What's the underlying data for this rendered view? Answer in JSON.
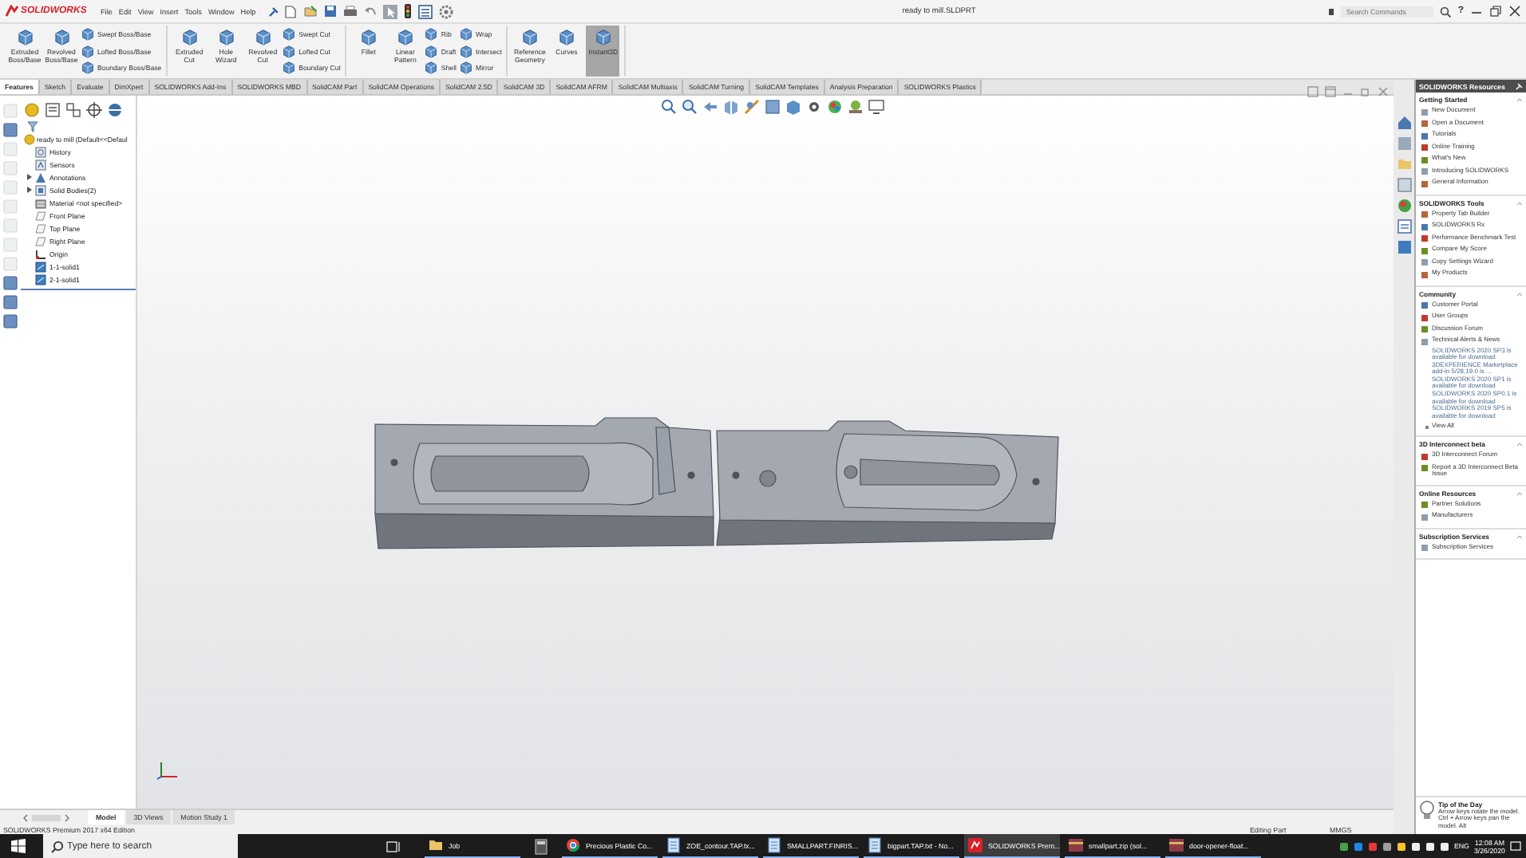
{
  "title_bar": {
    "logo": "SOLIDWORKS",
    "menus": [
      "File",
      "Edit",
      "View",
      "Insert",
      "Tools",
      "Window",
      "Help"
    ],
    "title": "ready to mill.SLDPRT",
    "search": {
      "placeholder": "Search Commands"
    },
    "help": "?"
  },
  "ribbon": {
    "groups": [
      {
        "items": [
          {
            "kind": "large",
            "label": "Extruded Boss/Base",
            "selected": false
          },
          {
            "kind": "large",
            "label": "Revolved Boss/Base",
            "selected": false
          },
          {
            "kind": "stack",
            "children": [
              "Swept Boss/Base",
              "Lofted Boss/Base",
              "Boundary Boss/Base"
            ]
          }
        ]
      },
      {
        "items": [
          {
            "kind": "large",
            "label": "Extruded Cut",
            "selected": false
          },
          {
            "kind": "large",
            "label": "Hole Wizard",
            "selected": false
          },
          {
            "kind": "large",
            "label": "Revolved Cut",
            "selected": false
          },
          {
            "kind": "stack",
            "children": [
              "Swept Cut",
              "Lofted Cut",
              "Boundary Cut"
            ]
          }
        ]
      },
      {
        "items": [
          {
            "kind": "large",
            "label": "Fillet",
            "selected": false
          },
          {
            "kind": "large",
            "label": "Linear Pattern",
            "selected": false
          },
          {
            "kind": "stack",
            "children": [
              "Rib",
              "Draft",
              "Shell"
            ]
          },
          {
            "kind": "stack",
            "children": [
              "Wrap",
              "Intersect",
              "Mirror"
            ]
          }
        ]
      },
      {
        "items": [
          {
            "kind": "large",
            "label": "Reference Geometry",
            "selected": false
          },
          {
            "kind": "large",
            "label": "Curves",
            "selected": false
          },
          {
            "kind": "large",
            "label": "Instant3D",
            "selected": true
          }
        ]
      }
    ]
  },
  "command_tabs": [
    {
      "label": "Features",
      "selected": true
    },
    {
      "label": "Sketch",
      "selected": false
    },
    {
      "label": "Evaluate",
      "selected": false
    },
    {
      "label": "DimXpert",
      "selected": false
    },
    {
      "label": "SOLIDWORKS Add-Ins",
      "selected": false
    },
    {
      "label": "SOLIDWORKS MBD",
      "selected": false
    },
    {
      "label": "SolidCAM Part",
      "selected": false
    },
    {
      "label": "SolidCAM Operations",
      "selected": false
    },
    {
      "label": "SolidCAM 2.5D",
      "selected": false
    },
    {
      "label": "SolidCAM 3D",
      "selected": false
    },
    {
      "label": "SolidCAM AFRM",
      "selected": false
    },
    {
      "label": "SolidCAM Multiaxis",
      "selected": false
    },
    {
      "label": "SolidCAM Turning",
      "selected": false
    },
    {
      "label": "SolidCAM Templates",
      "selected": false
    },
    {
      "label": "Analysis Preparation",
      "selected": false
    },
    {
      "label": "SOLIDWORKS Plastics",
      "selected": false
    }
  ],
  "feature_tree": {
    "root": "ready to mill  (Default<<Defaul",
    "items": [
      {
        "label": "History",
        "kind": "folder",
        "expandable": false
      },
      {
        "label": "Sensors",
        "kind": "sensor",
        "expandable": false
      },
      {
        "label": "Annotations",
        "kind": "annotation",
        "expandable": true
      },
      {
        "label": "Solid Bodies(2)",
        "kind": "bodies",
        "expandable": true
      },
      {
        "label": "Material <not specified>",
        "kind": "material",
        "expandable": false
      },
      {
        "label": "Front Plane",
        "kind": "plane",
        "expandable": false
      },
      {
        "label": "Top Plane",
        "kind": "plane",
        "expandable": false
      },
      {
        "label": "Right Plane",
        "kind": "plane",
        "expandable": false
      },
      {
        "label": "Origin",
        "kind": "origin",
        "expandable": false
      },
      {
        "label": "1-1-solid1",
        "kind": "feature",
        "expandable": false
      },
      {
        "label": "2-1-solid1",
        "kind": "feature",
        "expandable": false
      }
    ]
  },
  "bottom_tabs": [
    {
      "label": "Model",
      "selected": true
    },
    {
      "label": "3D Views",
      "selected": false
    },
    {
      "label": "Motion Study 1",
      "selected": false
    }
  ],
  "status_bar": {
    "edition": "SOLIDWORKS Premium 2017 x64 Edition",
    "mode": "Editing Part",
    "units": "MMGS"
  },
  "task_pane": {
    "title": "SOLIDWORKS Resources",
    "sections": [
      {
        "title": "Getting Started",
        "items": [
          {
            "kind": "link",
            "label": "New Document"
          },
          {
            "kind": "link",
            "label": "Open a Document"
          },
          {
            "kind": "link",
            "label": "Tutorials"
          },
          {
            "kind": "link",
            "label": "Online Training"
          },
          {
            "kind": "link",
            "label": "What's New"
          },
          {
            "kind": "link",
            "label": "Introducing SOLIDWORKS"
          },
          {
            "kind": "link",
            "label": "General Information"
          }
        ]
      },
      {
        "title": "SOLIDWORKS Tools",
        "items": [
          {
            "kind": "link",
            "label": "Property Tab Builder"
          },
          {
            "kind": "link",
            "label": "SOLIDWORKS Rx"
          },
          {
            "kind": "link",
            "label": "Performance Benchmark Test"
          },
          {
            "kind": "link",
            "label": "Compare My Score"
          },
          {
            "kind": "link",
            "label": "Copy Settings Wizard"
          },
          {
            "kind": "link",
            "label": "My Products"
          }
        ]
      },
      {
        "title": "Community",
        "items": [
          {
            "kind": "link",
            "label": "Customer Portal"
          },
          {
            "kind": "link",
            "label": "User Groups"
          },
          {
            "kind": "link",
            "label": "Discussion Forum"
          },
          {
            "kind": "link",
            "label": "Technical Alerts & News"
          },
          {
            "kind": "news",
            "label": "SOLIDWORKS 2020 SP3 is available for download"
          },
          {
            "kind": "news",
            "label": "3DEXPERIENCE Marketplace add-in 5/28,19.0 is ..."
          },
          {
            "kind": "news",
            "label": "SOLIDWORKS 2020 SP1 is available for download"
          },
          {
            "kind": "news",
            "label": "SOLIDWORKS 2020 SP0.1 is available for download"
          },
          {
            "kind": "news",
            "label": "SOLIDWORKS 2019 SP5 is available for download"
          },
          {
            "kind": "more",
            "label": "View All"
          }
        ]
      },
      {
        "title": "3D Interconnect beta",
        "items": [
          {
            "kind": "link",
            "label": "3D Interconnect Forum"
          },
          {
            "kind": "link",
            "label": "Report a 3D Interconnect Beta Issue"
          }
        ]
      },
      {
        "title": "Online Resources",
        "items": [
          {
            "kind": "link",
            "label": "Partner Solutions"
          },
          {
            "kind": "link",
            "label": "Manufacturers"
          }
        ]
      },
      {
        "title": "Subscription Services",
        "items": [
          {
            "kind": "link",
            "label": "Subscription Services"
          }
        ]
      }
    ],
    "tip": {
      "title": "Tip of the Day",
      "text": "Arrow keys rotate the model. Ctrl + Arrow keys pan the model. Alt"
    }
  },
  "taskbar": {
    "search": {
      "placeholder": "Type here to search"
    },
    "apps": [
      {
        "label": "Job",
        "kind": "folder",
        "selected": false
      },
      {
        "label": "Precious Plastic Co...",
        "kind": "browser",
        "selected": false
      },
      {
        "label": "ZOE_contour.TAP.tx...",
        "kind": "document",
        "selected": false
      },
      {
        "label": "SMALLPART.FINRIS...",
        "kind": "document",
        "selected": false
      },
      {
        "label": "bigpart.TAP.txt - No...",
        "kind": "document",
        "selected": false
      },
      {
        "label": "SOLIDWORKS Prem...",
        "kind": "solidworks",
        "selected": true
      },
      {
        "label": "smallpart.zip (sol...",
        "kind": "archive",
        "selected": false
      },
      {
        "label": "door-opener-float...",
        "kind": "archive",
        "selected": false
      }
    ],
    "clock": {
      "time": "12:08 AM",
      "date": "3/26/2020"
    },
    "language": "ENG"
  }
}
